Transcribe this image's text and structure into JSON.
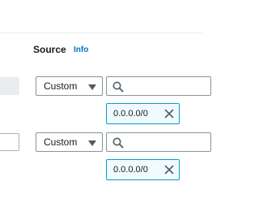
{
  "source_section": {
    "title": "Source",
    "info_label": "Info"
  },
  "rules": [
    {
      "source_type": "Custom",
      "search_placeholder": "",
      "cidr_tokens": [
        "0.0.0.0/0"
      ],
      "left_input_disabled": true
    },
    {
      "source_type": "Custom",
      "search_placeholder": "",
      "cidr_tokens": [
        "0.0.0.0/0"
      ],
      "left_input_disabled": false
    }
  ],
  "colors": {
    "link": "#0073bb",
    "token_border": "#00a1c9",
    "token_bg": "#f1faff",
    "input_border": "#879596"
  }
}
